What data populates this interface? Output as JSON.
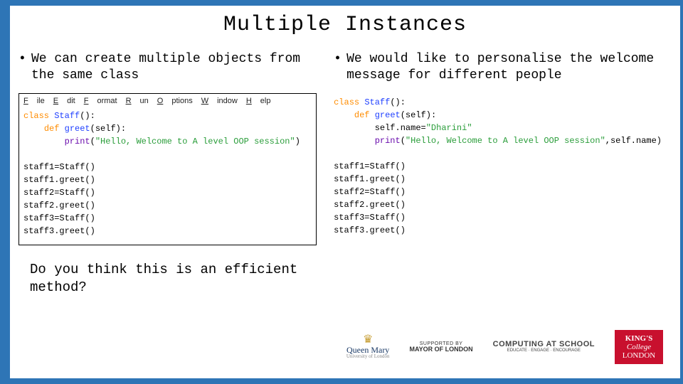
{
  "title": "Multiple Instances",
  "left": {
    "bullet": "We can create multiple objects from the same class",
    "menu": [
      "File",
      "Edit",
      "Format",
      "Run",
      "Options",
      "Window",
      "Help"
    ],
    "code": [
      {
        "cls": "kw",
        "t": "class "
      },
      {
        "cls": "cls",
        "t": "Staff"
      },
      {
        "cls": "",
        "t": "():"
      },
      {
        "br": 1
      },
      {
        "cls": "",
        "t": "    "
      },
      {
        "cls": "kw",
        "t": "def "
      },
      {
        "cls": "cls",
        "t": "greet"
      },
      {
        "cls": "",
        "t": "(self):"
      },
      {
        "br": 1
      },
      {
        "cls": "",
        "t": "        "
      },
      {
        "cls": "fn",
        "t": "print"
      },
      {
        "cls": "",
        "t": "("
      },
      {
        "cls": "str",
        "t": "\"Hello, Welcome to A level OOP session\""
      },
      {
        "cls": "",
        "t": ")"
      },
      {
        "br": 2
      },
      {
        "cls": "",
        "t": "staff1=Staff()"
      },
      {
        "br": 1
      },
      {
        "cls": "",
        "t": "staff1.greet()"
      },
      {
        "br": 1
      },
      {
        "cls": "",
        "t": "staff2=Staff()"
      },
      {
        "br": 1
      },
      {
        "cls": "",
        "t": "staff2.greet()"
      },
      {
        "br": 1
      },
      {
        "cls": "",
        "t": "staff3=Staff()"
      },
      {
        "br": 1
      },
      {
        "cls": "",
        "t": "staff3.greet()"
      }
    ],
    "question": "Do you think this is an efficient method?"
  },
  "right": {
    "bullet": "We would like to personalise the welcome message for different people",
    "code": [
      {
        "cls": "kw",
        "t": "class "
      },
      {
        "cls": "cls",
        "t": "Staff"
      },
      {
        "cls": "",
        "t": "():"
      },
      {
        "br": 1
      },
      {
        "cls": "",
        "t": "    "
      },
      {
        "cls": "kw",
        "t": "def "
      },
      {
        "cls": "cls",
        "t": "greet"
      },
      {
        "cls": "",
        "t": "(self):"
      },
      {
        "br": 1
      },
      {
        "cls": "",
        "t": "        self.name="
      },
      {
        "cls": "str",
        "t": "\"Dharini\""
      },
      {
        "br": 1
      },
      {
        "cls": "",
        "t": "        "
      },
      {
        "cls": "fn",
        "t": "print"
      },
      {
        "cls": "",
        "t": "("
      },
      {
        "cls": "str",
        "t": "\"Hello, Welcome to A level OOP session\""
      },
      {
        "cls": "",
        "t": ",self.name)"
      },
      {
        "br": 2
      },
      {
        "cls": "",
        "t": "staff1=Staff()"
      },
      {
        "br": 1
      },
      {
        "cls": "",
        "t": "staff1.greet()"
      },
      {
        "br": 1
      },
      {
        "cls": "",
        "t": "staff2=Staff()"
      },
      {
        "br": 1
      },
      {
        "cls": "",
        "t": "staff2.greet()"
      },
      {
        "br": 1
      },
      {
        "cls": "",
        "t": "staff3=Staff()"
      },
      {
        "br": 1
      },
      {
        "cls": "",
        "t": "staff3.greet()"
      }
    ]
  },
  "logos": {
    "qmul": "Queen Mary",
    "qmul_sub": "University of London",
    "mol_sup": "SUPPORTED BY",
    "mol": "MAYOR OF LONDON",
    "cas": "COMPUTING AT SCHOOL",
    "cas_sub": "EDUCATE · ENGAGE · ENCOURAGE",
    "kcl1": "KING'S",
    "kcl2": "College",
    "kcl3": "LONDON"
  }
}
